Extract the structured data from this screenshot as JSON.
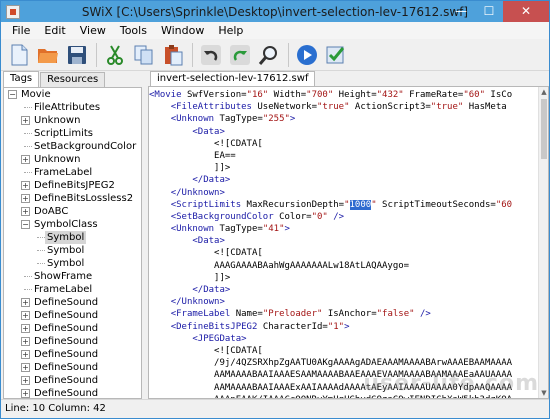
{
  "window": {
    "title": "SWiX [C:\\Users\\Sprinkle\\Desktop\\invert-selection-lev-17612.swf]",
    "minimize": "—",
    "maximize": "☐",
    "close": "✕"
  },
  "menu": [
    "File",
    "Edit",
    "View",
    "Tools",
    "Window",
    "Help"
  ],
  "toolbar": {
    "icons": [
      "new-file-icon",
      "open-folder-icon",
      "save-icon",
      "cut-icon",
      "copy-icon",
      "paste-icon",
      "undo-icon",
      "redo-icon",
      "search-icon",
      "play-icon",
      "validate-icon"
    ]
  },
  "left_tabs": [
    "Tags",
    "Resources"
  ],
  "tree": [
    {
      "label": "Movie",
      "depth": 0,
      "expander": "−"
    },
    {
      "label": "FileAttributes",
      "depth": 1,
      "expander": ""
    },
    {
      "label": "Unknown",
      "depth": 1,
      "expander": "+"
    },
    {
      "label": "ScriptLimits",
      "depth": 1,
      "expander": ""
    },
    {
      "label": "SetBackgroundColor",
      "depth": 1,
      "expander": ""
    },
    {
      "label": "Unknown",
      "depth": 1,
      "expander": "+"
    },
    {
      "label": "FrameLabel",
      "depth": 1,
      "expander": ""
    },
    {
      "label": "DefineBitsJPEG2",
      "depth": 1,
      "expander": "+"
    },
    {
      "label": "DefineBitsLossless2",
      "depth": 1,
      "expander": "+"
    },
    {
      "label": "DoABC",
      "depth": 1,
      "expander": "+"
    },
    {
      "label": "SymbolClass",
      "depth": 1,
      "expander": "−"
    },
    {
      "label": "Symbol",
      "depth": 2,
      "expander": "",
      "selected": true
    },
    {
      "label": "Symbol",
      "depth": 2,
      "expander": ""
    },
    {
      "label": "Symbol",
      "depth": 2,
      "expander": ""
    },
    {
      "label": "ShowFrame",
      "depth": 1,
      "expander": ""
    },
    {
      "label": "FrameLabel",
      "depth": 1,
      "expander": ""
    },
    {
      "label": "DefineSound",
      "depth": 1,
      "expander": "+"
    },
    {
      "label": "DefineSound",
      "depth": 1,
      "expander": "+"
    },
    {
      "label": "DefineSound",
      "depth": 1,
      "expander": "+"
    },
    {
      "label": "DefineSound",
      "depth": 1,
      "expander": "+"
    },
    {
      "label": "DefineSound",
      "depth": 1,
      "expander": "+"
    },
    {
      "label": "DefineSound",
      "depth": 1,
      "expander": "+"
    },
    {
      "label": "DefineSound",
      "depth": 1,
      "expander": "+"
    },
    {
      "label": "DefineSound",
      "depth": 1,
      "expander": "+"
    }
  ],
  "editor": {
    "tab_label": "invert-selection-lev-17612.swf",
    "lines": [
      [
        [
          "tag",
          "<Movie "
        ],
        [
          "attr",
          "SwfVersion="
        ],
        [
          "val",
          "\"16\""
        ],
        [
          "attr",
          " Width="
        ],
        [
          "val",
          "\"700\""
        ],
        [
          "attr",
          " Height="
        ],
        [
          "val",
          "\"432\""
        ],
        [
          "attr",
          " FrameRate="
        ],
        [
          "val",
          "\"60\""
        ],
        [
          "attr",
          " IsCo"
        ]
      ],
      [
        [
          "txt",
          "    "
        ],
        [
          "tag",
          "<FileAttributes "
        ],
        [
          "attr",
          "UseNetwork="
        ],
        [
          "val",
          "\"true\""
        ],
        [
          "attr",
          " ActionScript3="
        ],
        [
          "val",
          "\"true\""
        ],
        [
          "attr",
          " HasMeta"
        ]
      ],
      [
        [
          "txt",
          "    "
        ],
        [
          "tag",
          "<Unknown "
        ],
        [
          "attr",
          "TagType="
        ],
        [
          "val",
          "\"255\""
        ],
        [
          "tag",
          ">"
        ]
      ],
      [
        [
          "txt",
          "        "
        ],
        [
          "tag",
          "<Data>"
        ]
      ],
      [
        [
          "txt",
          "            <![CDATA["
        ]
      ],
      [
        [
          "txt",
          "            EA=="
        ]
      ],
      [
        [
          "txt",
          "            ]]>"
        ]
      ],
      [
        [
          "txt",
          "        "
        ],
        [
          "tag",
          "</Data>"
        ]
      ],
      [
        [
          "txt",
          "    "
        ],
        [
          "tag",
          "</Unknown>"
        ]
      ],
      [
        [
          "txt",
          "    "
        ],
        [
          "tag",
          "<ScriptLimits "
        ],
        [
          "attr",
          "MaxRecursionDepth="
        ],
        [
          "val",
          "\""
        ],
        [
          "hl",
          "1000"
        ],
        [
          "val",
          "\""
        ],
        [
          "attr",
          " ScriptTimeoutSeconds="
        ],
        [
          "val",
          "\"60"
        ]
      ],
      [
        [
          "txt",
          "    "
        ],
        [
          "tag",
          "<SetBackgroundColor "
        ],
        [
          "attr",
          "Color="
        ],
        [
          "val",
          "\"0\""
        ],
        [
          "tag",
          " />"
        ]
      ],
      [
        [
          "txt",
          "    "
        ],
        [
          "tag",
          "<Unknown "
        ],
        [
          "attr",
          "TagType="
        ],
        [
          "val",
          "\"41\""
        ],
        [
          "tag",
          ">"
        ]
      ],
      [
        [
          "txt",
          "        "
        ],
        [
          "tag",
          "<Data>"
        ]
      ],
      [
        [
          "txt",
          "            <![CDATA["
        ]
      ],
      [
        [
          "txt",
          "            AAAGAAAABAahWgAAAAAAALw18AtLAQAAygo="
        ]
      ],
      [
        [
          "txt",
          "            ]]>"
        ]
      ],
      [
        [
          "txt",
          "        "
        ],
        [
          "tag",
          "</Data>"
        ]
      ],
      [
        [
          "txt",
          "    "
        ],
        [
          "tag",
          "</Unknown>"
        ]
      ],
      [
        [
          "txt",
          "    "
        ],
        [
          "tag",
          "<FrameLabel "
        ],
        [
          "attr",
          "Name="
        ],
        [
          "val",
          "\"Preloader\""
        ],
        [
          "attr",
          " IsAnchor="
        ],
        [
          "val",
          "\"false\""
        ],
        [
          "tag",
          " />"
        ]
      ],
      [
        [
          "txt",
          "    "
        ],
        [
          "tag",
          "<DefineBitsJPEG2 "
        ],
        [
          "attr",
          "CharacterId="
        ],
        [
          "val",
          "\"1\""
        ],
        [
          "tag",
          ">"
        ]
      ],
      [
        [
          "txt",
          "        "
        ],
        [
          "tag",
          "<JPEGData>"
        ]
      ],
      [
        [
          "txt",
          "            <![CDATA["
        ]
      ],
      [
        [
          "txt",
          "            /9j/4QZSRXhpZgAATU0AKgAAAAgADAEAAAMAAAABArwAAAEBAAMAAAA"
        ]
      ],
      [
        [
          "txt",
          "            AAMAAAABAAIAAAESAAMAAAABAAEAAAEVAAMAAAABAAMAAAEaAAUAAAA"
        ]
      ],
      [
        [
          "txt",
          "            AAMAAAABAAIAAAExAAIAAAAdAAAAtAEyAAIAAAAUAAAA0YdpAAQAAAA"
        ]
      ],
      [
        [
          "txt",
          "            AAAnEAAK/IAAACcQQNRvYmUgUGhvdG9zaG9wIENDIChXaW5kb3dzKQA"
        ]
      ]
    ]
  },
  "status": "Line: 10 Column: 42",
  "watermark": "user-life.com"
}
